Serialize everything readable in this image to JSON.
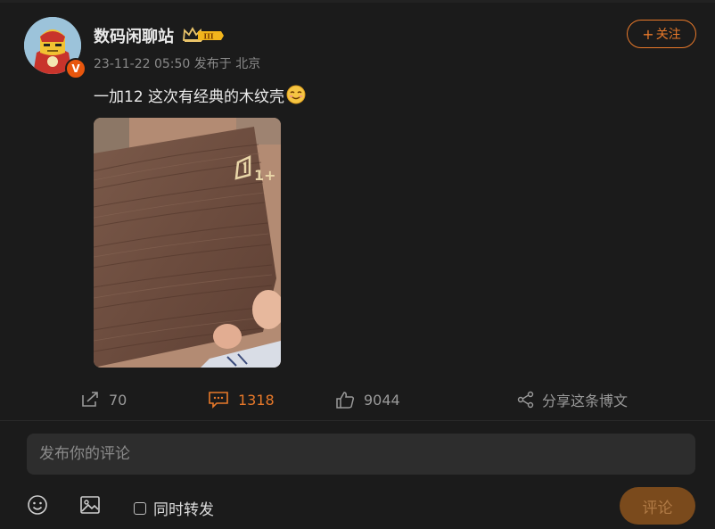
{
  "post": {
    "username": "数码闲聊站",
    "level_badge": "III",
    "meta": "23-11-22 05:50 发布于 北京",
    "follow_label": "关注",
    "text": "一加12 这次有经典的木纹壳",
    "photo_logo_text": "1+"
  },
  "actions": {
    "repost_count": "70",
    "comment_count": "1318",
    "like_count": "9044",
    "share_label": "分享这条博文"
  },
  "composer": {
    "placeholder": "发布你的评论",
    "repost_label": "同时转发",
    "submit_label": "评论"
  },
  "colors": {
    "accent": "#e8792a",
    "background": "#1b1b1b",
    "muted": "#9a9a9a"
  },
  "icons": [
    "verified-v-icon",
    "crown-icon",
    "smile-emoji-icon",
    "repost-icon",
    "comment-icon",
    "like-icon",
    "share-icon",
    "emoji-icon",
    "image-icon",
    "checkbox-icon"
  ]
}
